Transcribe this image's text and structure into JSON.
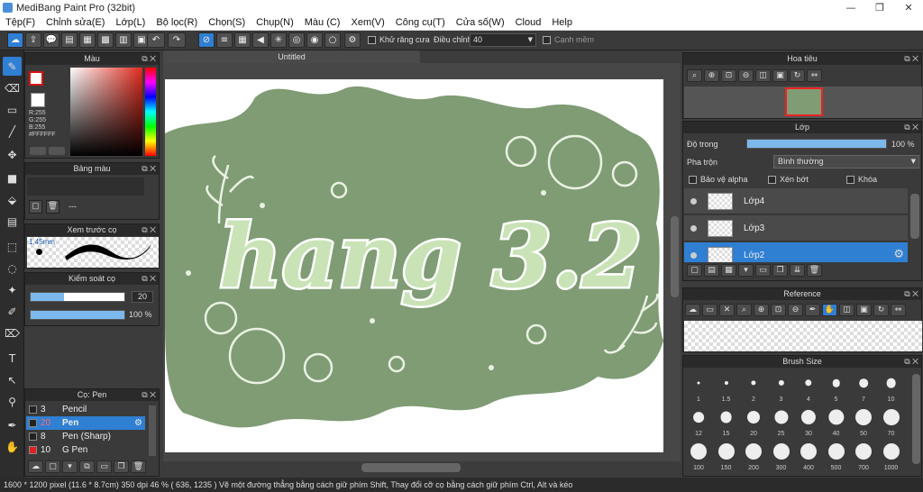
{
  "window": {
    "title": "MediBang Paint Pro (32bit)"
  },
  "menu": [
    "Tệp(F)",
    "Chỉnh sửa(E)",
    "Lớp(L)",
    "Bộ lọc(R)",
    "Chọn(S)",
    "Chụp(N)",
    "Màu (C)",
    "Xem(V)",
    "Công cụ(T)",
    "Cửa số(W)",
    "Cloud",
    "Help"
  ],
  "toolbar": {
    "antialias_label": "Khử răng cưa",
    "adjust_label": "Điều chỉnh",
    "adjust_value": "40",
    "snap_label": "Cạnh mềm"
  },
  "color_panel": {
    "title": "Màu",
    "r": "R:255",
    "g": "G:255",
    "b": "B:255",
    "hex": "#FFFFFF"
  },
  "palette_panel": {
    "title": "Bảng màu",
    "dash": "---"
  },
  "preview_panel": {
    "title": "Xem trước cọ",
    "size": "1.45mm"
  },
  "brush_control": {
    "title": "Kiểm soát cọ",
    "size_value": "20",
    "opacity_value": "100 %",
    "size_fraction": 0.36,
    "opacity_fraction": 1.0
  },
  "brush_panel": {
    "title": "Cọ: Pen",
    "items": [
      {
        "n": "3",
        "name": "Pencil",
        "sel": false,
        "color": "#222222"
      },
      {
        "n": "20",
        "name": "Pen",
        "sel": true,
        "color": "#222222"
      },
      {
        "n": "8",
        "name": "Pen (Sharp)",
        "sel": false,
        "color": "#222222"
      },
      {
        "n": "10",
        "name": "G Pen",
        "sel": false,
        "color": "#e02020"
      }
    ]
  },
  "document": {
    "tab": "Untitled",
    "art_text": "hang 3.2",
    "bg_color": "#7f9c74"
  },
  "navigator": {
    "title": "Hoa tiêu"
  },
  "layers": {
    "title": "Lớp",
    "opacity_label": "Độ trong",
    "opacity_value": "100 %",
    "opacity_fraction": 1.0,
    "blend_label": "Pha trộn",
    "blend_value": "Bình thường",
    "protect_label": "Bảo vệ alpha",
    "clip_label": "Xén bớt",
    "lock_label": "Khóa",
    "items": [
      {
        "name": "Lớp4",
        "sel": false
      },
      {
        "name": "Lớp3",
        "sel": false
      },
      {
        "name": "Lớp2",
        "sel": true
      }
    ]
  },
  "reference": {
    "title": "Reference"
  },
  "brush_size": {
    "title": "Brush Size",
    "sizes": [
      "1",
      "1.5",
      "2",
      "3",
      "4",
      "5",
      "7",
      "10",
      "12",
      "15",
      "20",
      "25",
      "30",
      "40",
      "50",
      "70",
      "100",
      "150",
      "200",
      "300",
      "400",
      "500",
      "700",
      "1000"
    ]
  },
  "status": {
    "text": "1600 * 1200 pixel   (11.6 * 8.7cm)   350 dpi   46 %   ( 636, 1235 )  Vẽ một đường thẳng bằng cách giữ phím Shift, Thay đổi cỡ cọ bằng cách giữ phím Ctrl, Alt và kéo"
  },
  "colors": {
    "accent": "#2f7fd3",
    "panel": "#3a3a3a",
    "header": "#2a2a2a"
  }
}
